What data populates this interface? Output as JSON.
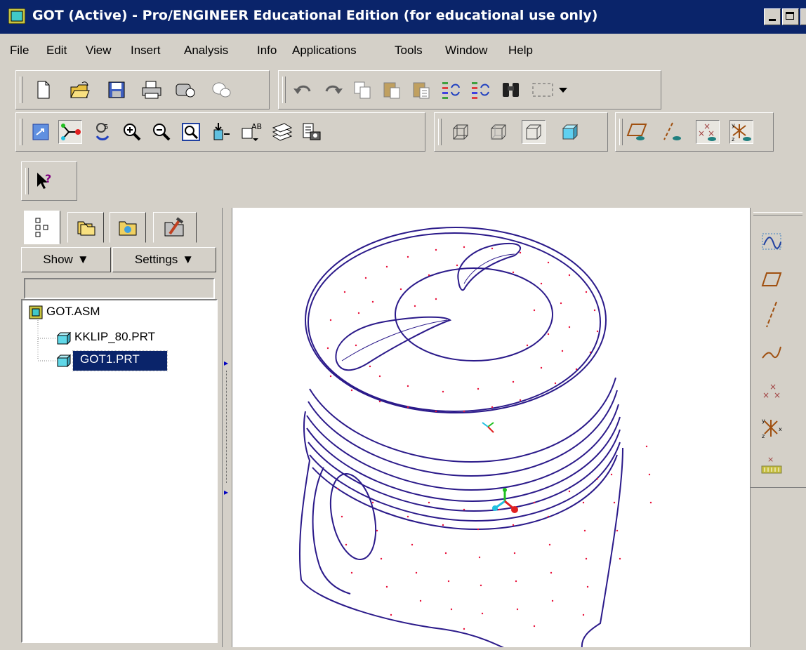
{
  "window": {
    "title": "GOT (Active) - Pro/ENGINEER Educational Edition (for educational use only)"
  },
  "menu": {
    "items": [
      "File",
      "Edit",
      "View",
      "Insert",
      "Analysis",
      "Info",
      "Applications",
      "Tools",
      "Window",
      "Help"
    ]
  },
  "toolbar": {
    "file_icons": [
      "new-file-icon",
      "open-folder-icon",
      "save-icon",
      "print-icon",
      "send-mail-icon",
      "link-icon"
    ],
    "edit_icons": [
      "undo-icon",
      "redo-icon",
      "copy-icon",
      "paste-icon",
      "paste-special-icon",
      "regenerate-icon",
      "regen-manager-icon",
      "find-icon",
      "select-box-icon"
    ],
    "view_icons": [
      "repaint-icon",
      "spin-center-icon",
      "orient-mode-icon",
      "zoom-in-icon",
      "zoom-out-icon",
      "refit-icon",
      "reorient-icon",
      "saved-views-icon",
      "layers-icon",
      "view-manager-icon"
    ],
    "display_icons": [
      "wireframe-icon",
      "hidden-line-icon",
      "no-hidden-icon",
      "shading-icon"
    ],
    "datum_icons": [
      "datum-planes-icon",
      "datum-axes-icon",
      "datum-points-icon",
      "coord-systems-icon"
    ],
    "help_icon": "context-help-icon"
  },
  "model_tree": {
    "tabs": [
      "model-tree-icon",
      "folder-browser-icon",
      "favorites-icon",
      "connections-icon"
    ],
    "show_label": "Show",
    "settings_label": "Settings",
    "items": [
      {
        "label": "GOT.ASM",
        "type": "assembly"
      },
      {
        "label": "KKLIP_80.PRT",
        "type": "part"
      },
      {
        "label": "GOT1.PRT",
        "type": "part",
        "selected": true
      }
    ]
  },
  "right_toolbar": {
    "icons": [
      "sketch-curve-icon",
      "datum-plane-tool-icon",
      "datum-axis-tool-icon",
      "datum-curve-icon",
      "datum-point-tool-icon",
      "coord-sys-tool-icon",
      "analysis-feature-icon"
    ]
  },
  "colors": {
    "title_bar": "#0a246a",
    "face": "#d4d0c8",
    "model_edges": "#2b1a8a",
    "model_points": "#e8103a",
    "selection": "#0a246a"
  }
}
